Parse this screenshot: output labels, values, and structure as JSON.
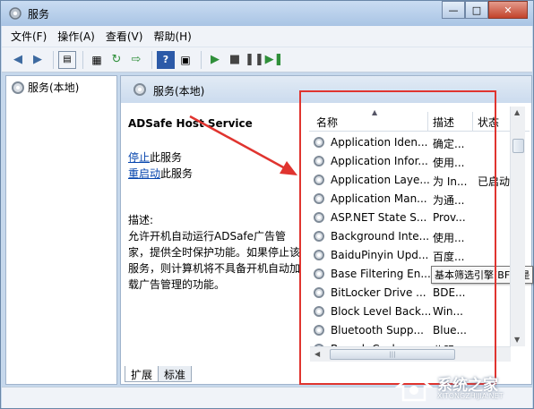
{
  "window": {
    "title": "服务",
    "controls": {
      "minimize": "—",
      "maximize": "□",
      "close": "✕"
    }
  },
  "menu": [
    "文件(F)",
    "操作(A)",
    "查看(V)",
    "帮助(H)"
  ],
  "tree": {
    "root": "服务(本地)"
  },
  "main": {
    "header": "服务(本地)",
    "selected_service": "ADSafe Host Service",
    "stop_link": "停止",
    "stop_suffix": "此服务",
    "restart_link": "重启动",
    "restart_suffix": "此服务",
    "description_label": "描述:",
    "description_text": "允许开机自动运行ADSafe广告管家，提供全时保护功能。如果停止该服务，则计算机将不具备开机自动加载广告管理的功能。"
  },
  "list": {
    "columns": {
      "name": "名称",
      "description": "描述",
      "status": "状态"
    },
    "rows": [
      {
        "name": "Application Iden...",
        "desc": "确定...",
        "status": ""
      },
      {
        "name": "Application Infor...",
        "desc": "使用...",
        "status": ""
      },
      {
        "name": "Application Laye...",
        "desc": "为 In...",
        "status": "已启动"
      },
      {
        "name": "Application Man...",
        "desc": "为通...",
        "status": ""
      },
      {
        "name": "ASP.NET State S...",
        "desc": "Prov...",
        "status": ""
      },
      {
        "name": "Background Inte...",
        "desc": "使用...",
        "status": ""
      },
      {
        "name": "BaiduPinyin Upd...",
        "desc": "百度...",
        "status": ""
      },
      {
        "name": "Base Filtering En...",
        "desc": "",
        "status": ""
      },
      {
        "name": "BitLocker Drive ...",
        "desc": "BDE...",
        "status": ""
      },
      {
        "name": "Block Level Back...",
        "desc": "Win...",
        "status": ""
      },
      {
        "name": "Bluetooth Supp...",
        "desc": "Blue...",
        "status": ""
      },
      {
        "name": "Branch Cache",
        "desc": "此服...",
        "status": ""
      }
    ],
    "tooltip": "基本筛选引擎(BFE)是"
  },
  "tabs": [
    "扩展",
    "标准"
  ],
  "watermark": {
    "text": "系统之家",
    "sub": "XITONGZHIJIA.NET"
  },
  "colors": {
    "annotation": "#e0342f",
    "link": "#0645ad"
  }
}
